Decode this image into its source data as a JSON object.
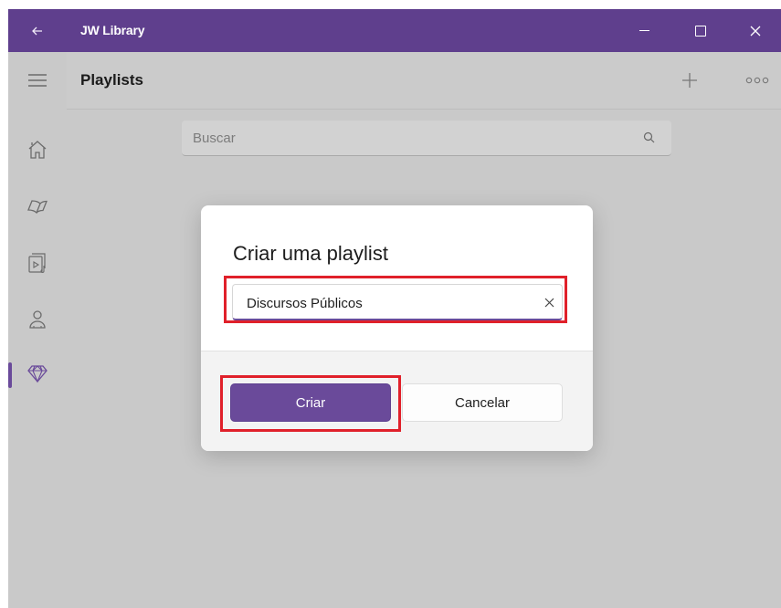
{
  "window": {
    "title": "JW Library",
    "accent_color": "#5f3f8d",
    "back_icon": "arrow-left-icon",
    "controls": [
      "minimize-icon",
      "maximize-icon",
      "close-icon"
    ]
  },
  "sidebar": {
    "items": [
      {
        "icon": "menu-icon"
      },
      {
        "icon": "home-icon"
      },
      {
        "icon": "book-icon"
      },
      {
        "icon": "media-icon"
      },
      {
        "icon": "person-icon"
      },
      {
        "icon": "gem-icon",
        "active": true
      }
    ]
  },
  "header": {
    "title": "Playlists",
    "add_icon": "plus-icon",
    "more_icon": "more-icon"
  },
  "search": {
    "placeholder": "Buscar",
    "value": ""
  },
  "dialog": {
    "title": "Criar uma playlist",
    "name_field_value": "Discursos Públicos",
    "clear_icon": "close-icon",
    "primary_button": "Criar",
    "secondary_button": "Cancelar"
  },
  "annotations": {
    "highlight_color": "#e0202a"
  }
}
